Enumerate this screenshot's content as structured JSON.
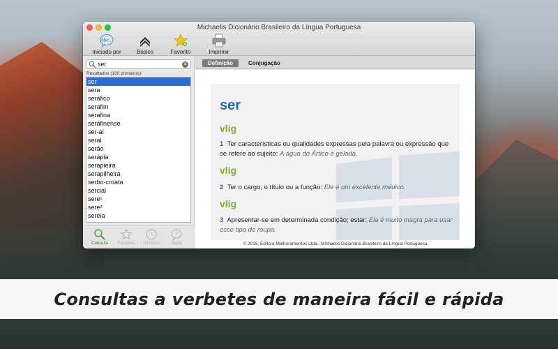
{
  "window": {
    "title": "Michaelis Dicionário Brasileiro da Língua Portuguesa"
  },
  "toolbar": {
    "items": [
      {
        "label": "Iniciado por",
        "icon": "abc-bubble-icon"
      },
      {
        "label": "Básico",
        "icon": "chevron-rank-icon"
      },
      {
        "label": "Favorito",
        "icon": "star-icon"
      },
      {
        "label": "Imprimir",
        "icon": "printer-icon"
      }
    ]
  },
  "search": {
    "value": "ser",
    "placeholder": ""
  },
  "results": {
    "label": "Resultados (100 primeiros):",
    "items": [
      "ser",
      "sera",
      "seráfico",
      "serafim",
      "serafina",
      "serafinense",
      "ser-aí",
      "seral",
      "serão",
      "serápia",
      "serapieira",
      "serapilheira",
      "serbo-croata",
      "sercial",
      "sere¹",
      "sere²",
      "sereia"
    ],
    "selected_index": 0
  },
  "bottom_tabs": [
    {
      "label": "Consulta",
      "icon": "magnifier-icon",
      "active": true
    },
    {
      "label": "Favoritos",
      "icon": "star-outline-icon",
      "active": false
    },
    {
      "label": "Histórico",
      "icon": "clock-icon",
      "active": false
    },
    {
      "label": "Ajuda",
      "icon": "help-bubble-icon",
      "active": false
    }
  ],
  "content_tabs": {
    "definicao": "Definição",
    "conjugacao": "Conjugação"
  },
  "entry": {
    "headword": "ser",
    "senses": [
      {
        "pos": "vlig",
        "number": "1",
        "text": "Ter características ou qualidades expressas pela palavra ou expressão que se refere ao sujeito:",
        "example": "A água do Ártico é gelada."
      },
      {
        "pos": "vlig",
        "number": "2",
        "text": "Ter o cargo, o título ou a função:",
        "example": "Ele é um excelente médico."
      },
      {
        "pos": "vlig",
        "number": "3",
        "text": "Apresentar-se em determinada condição; estar:",
        "example": "Ela é muito magra para usar esse tipo de roupa."
      }
    ]
  },
  "copyright": "© 2018, Editora Melhoramentos Ltda., Michaelis Dicionário Brasileiro da Língua Portuguesa",
  "caption": "Consultas a verbetes de maneira fácil e rápida",
  "colors": {
    "accent_blue": "#1d6fb0",
    "pos_green": "#7cab35",
    "selection": "#2d6ed6"
  }
}
